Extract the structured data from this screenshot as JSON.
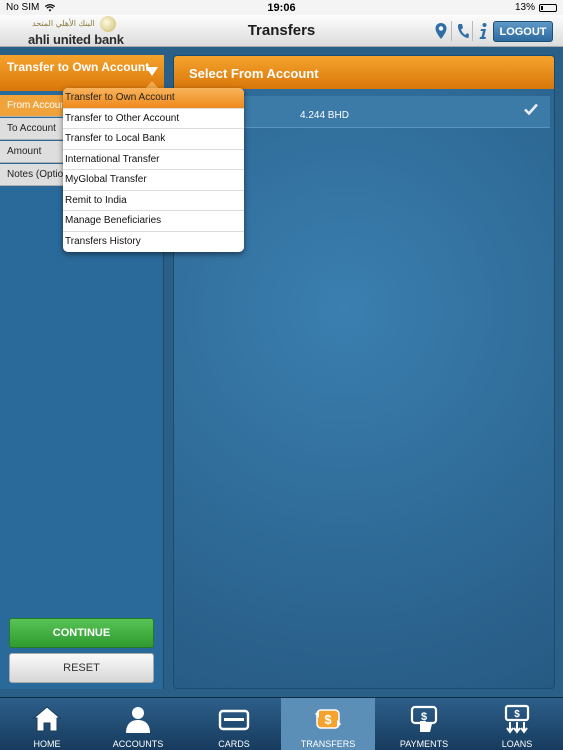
{
  "status_bar": {
    "carrier": "No SIM",
    "time": "19:06",
    "battery": "13%",
    "battery_level": 0.13
  },
  "header": {
    "logo_arabic": "البنك الأهلي المتحد",
    "logo_name": "ahli united bank",
    "title": "Transfers",
    "logout_label": "LOGOUT"
  },
  "left_panel": {
    "selected_type": "Transfer to Own Account",
    "fields": [
      {
        "label": "From Account"
      },
      {
        "label": "To Account"
      },
      {
        "label": "Amount"
      },
      {
        "label": "Notes (Optional)"
      }
    ],
    "continue_label": "CONTINUE",
    "reset_label": "RESET"
  },
  "right_panel": {
    "title": "Select From Account",
    "accounts": [
      {
        "balance": "4.244 BHD",
        "selected": true
      }
    ]
  },
  "dropdown_menu": {
    "items": [
      {
        "label": "Transfer to Own Account",
        "selected": true
      },
      {
        "label": "Transfer to Other Account"
      },
      {
        "label": "Transfer to Local Bank"
      },
      {
        "label": "International Transfer"
      },
      {
        "label": "MyGlobal Transfer"
      },
      {
        "label": "Remit to India"
      },
      {
        "label": "Manage Beneficiaries"
      },
      {
        "label": "Transfers History"
      }
    ]
  },
  "tab_bar": {
    "tabs": [
      {
        "label": "HOME",
        "icon": "home-icon"
      },
      {
        "label": "ACCOUNTS",
        "icon": "person-icon"
      },
      {
        "label": "CARDS",
        "icon": "card-icon"
      },
      {
        "label": "TRANSFERS",
        "icon": "transfer-icon",
        "active": true
      },
      {
        "label": "PAYMENTS",
        "icon": "payment-icon"
      },
      {
        "label": "LOANS",
        "icon": "loan-icon"
      }
    ]
  },
  "colors": {
    "accent_orange": "#ef8a1b",
    "background_blue": "#2a5f88",
    "continue_green": "#3fa83e"
  }
}
